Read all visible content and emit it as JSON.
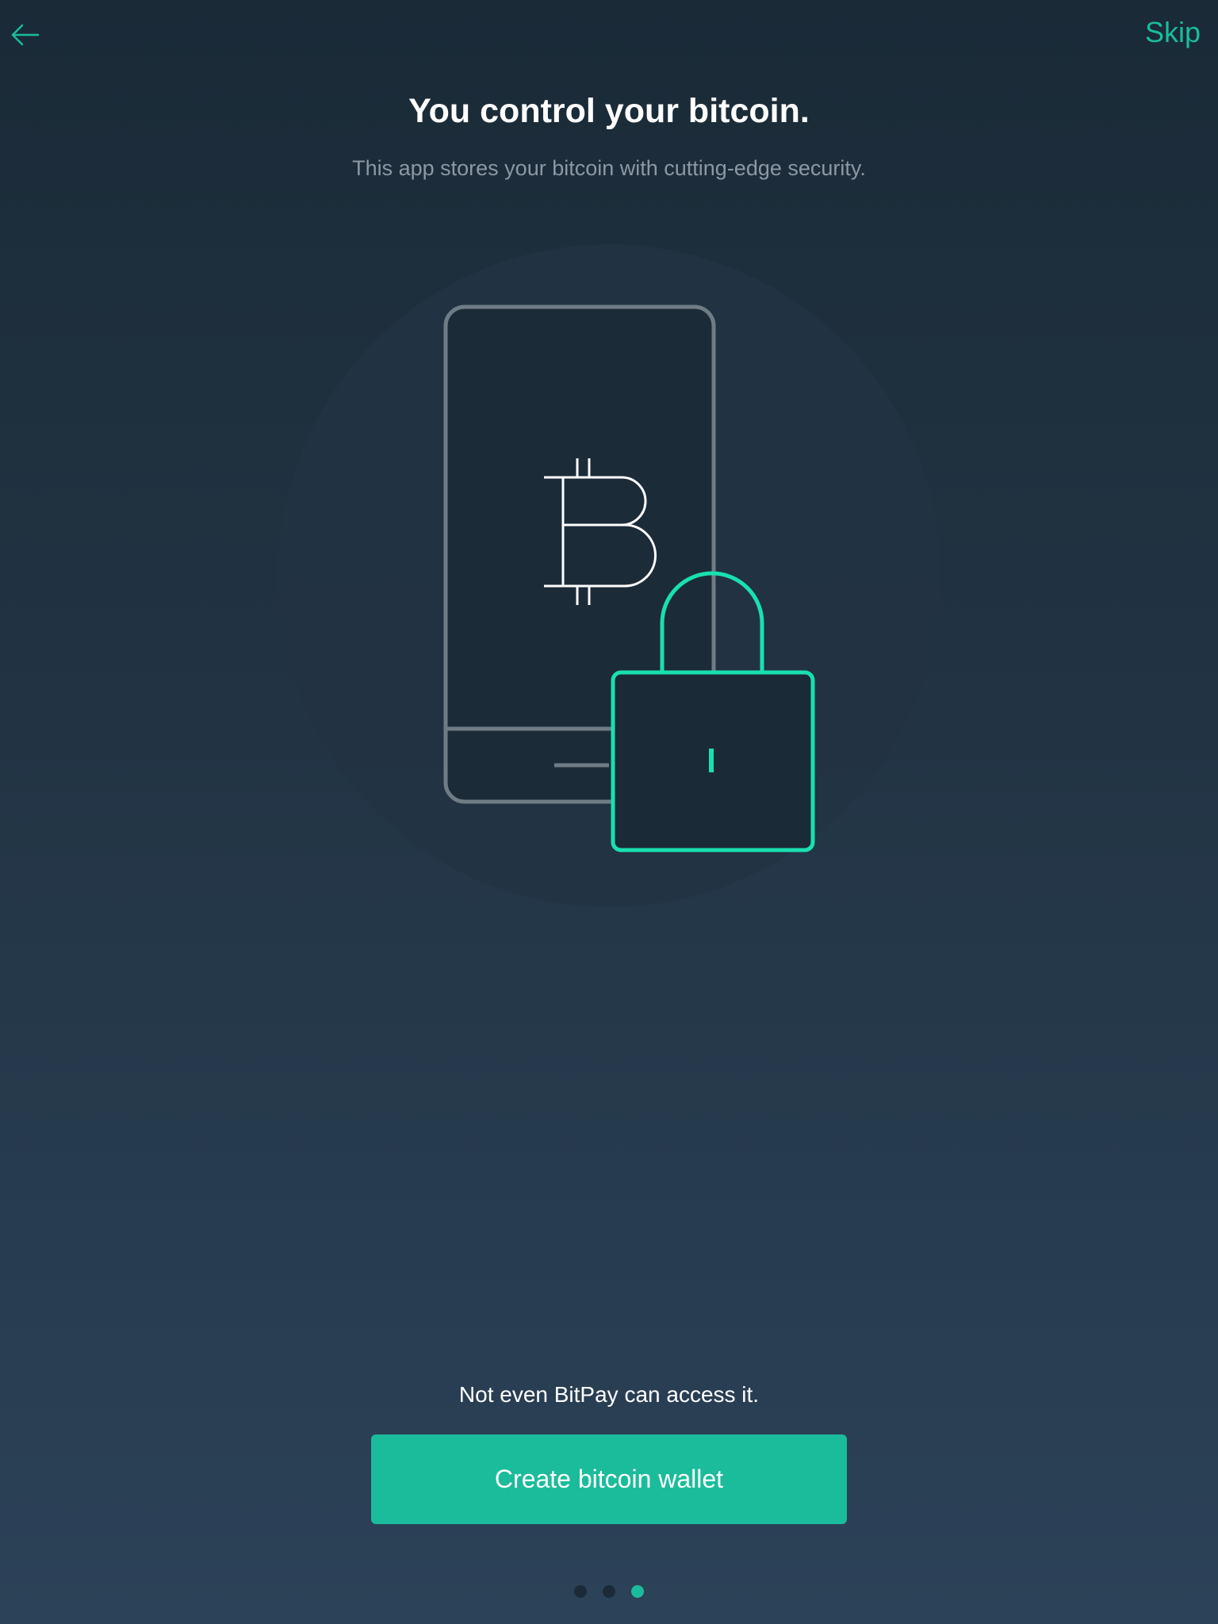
{
  "header": {
    "back_icon": "arrow-left-icon",
    "skip_label": "Skip"
  },
  "intro": {
    "title": "You control your bitcoin.",
    "subtitle": "This app stores your bitcoin with cutting-edge security."
  },
  "illustration": {
    "icons": [
      "phone-icon",
      "bitcoin-icon",
      "padlock-icon"
    ]
  },
  "footer": {
    "note": "Not even BitPay can access it.",
    "create_wallet_label": "Create bitcoin wallet"
  },
  "pager": {
    "total": 3,
    "current": 3
  },
  "colors": {
    "accent": "#1bbc9b",
    "lock_stroke": "#19e0b0",
    "background_top": "#1a2a37",
    "background_bottom": "#2c4258",
    "subtitle_text": "#8c98a3",
    "phone_stroke": "#6f7c86"
  }
}
